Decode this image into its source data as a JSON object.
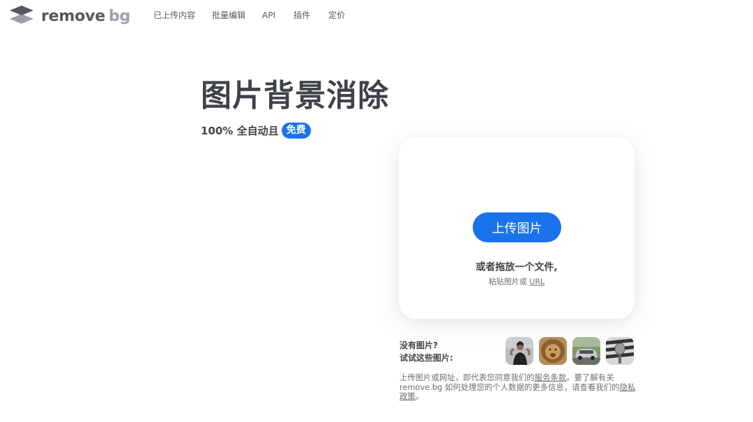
{
  "brand": {
    "name_part1": "remove",
    "name_part2": "bg",
    "logo_icon": "layers-icon"
  },
  "nav": {
    "items": [
      {
        "label": "已上传内容"
      },
      {
        "label": "批量编辑"
      },
      {
        "label": "API"
      },
      {
        "label": "插件"
      },
      {
        "label": "定价"
      }
    ]
  },
  "hero": {
    "title": "图片背景消除",
    "subtitle": "100% 全自动且",
    "badge": "免费"
  },
  "upload": {
    "button_label": "上传图片",
    "drop_text": "或者拖放一个文件,",
    "paste_text": "粘贴图片或",
    "url_link": "URL"
  },
  "samples": {
    "line1": "没有图片?",
    "line2": "试试这些图片:",
    "images": [
      {
        "alt": "woman"
      },
      {
        "alt": "lion"
      },
      {
        "alt": "car"
      },
      {
        "alt": "microphone"
      }
    ]
  },
  "legal": {
    "text1": "上传图片或网址，即代表您同意我们的",
    "terms_link": "服务条款",
    "text2": "。要了解有关 remove.bg 如何处理您的个人数据的更多信息，请查看我们的",
    "privacy_link": "隐私政策",
    "text3": "。"
  },
  "colors": {
    "accent": "#1a73e8",
    "text": "#454545",
    "muted": "#6b6f73"
  }
}
